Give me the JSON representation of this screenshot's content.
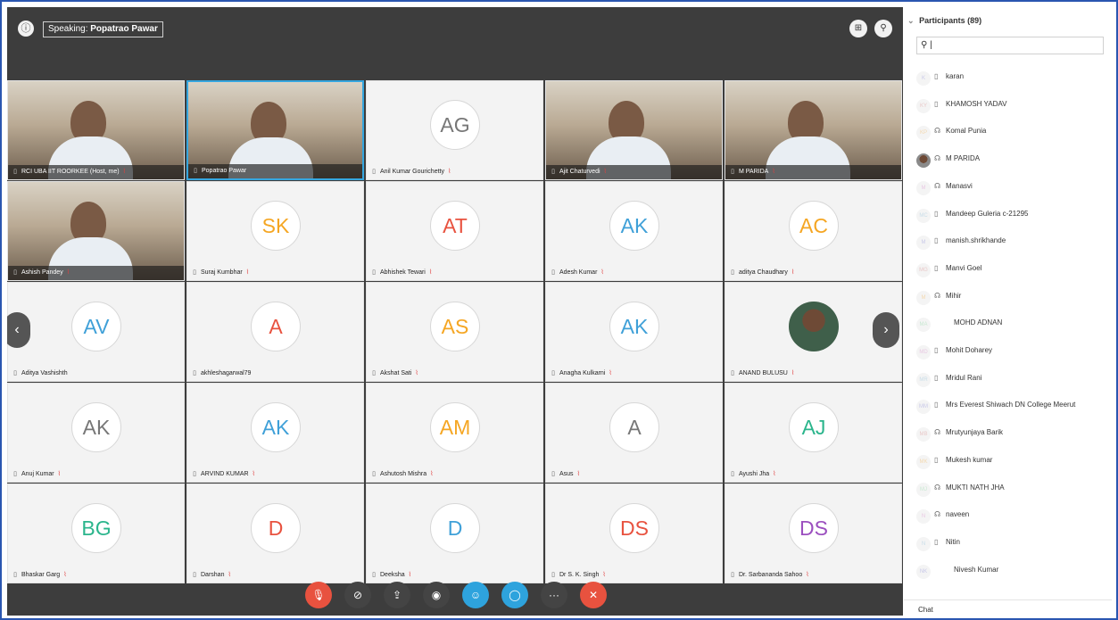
{
  "topbar": {
    "info_icon": "info-icon",
    "speaking_label": "Speaking:",
    "speaking_name": "Popatrao Pawar",
    "layout_icon": "grid-layout-icon",
    "options_icon": "pin-icon"
  },
  "tiles": [
    {
      "name": "RCI UBA IIT ROORKEE (Host, me)",
      "type": "video",
      "muted": true
    },
    {
      "name": "Popatrao Pawar",
      "type": "video",
      "active": true
    },
    {
      "name": "Anil Kumar Gourichetty",
      "initials": "AG",
      "color": "#777777",
      "muted": true
    },
    {
      "name": "Ajit Chaturvedi",
      "type": "video",
      "muted": true
    },
    {
      "name": "M PARIDA",
      "type": "video",
      "muted": true
    },
    {
      "name": "Ashish Pandey",
      "type": "video",
      "muted": true
    },
    {
      "name": "Suraj Kumbhar",
      "initials": "SK",
      "color": "#f5a623",
      "muted": true
    },
    {
      "name": "Abhishek Tewari",
      "initials": "AT",
      "color": "#e8523f",
      "muted": true
    },
    {
      "name": "Adesh Kumar",
      "initials": "AK",
      "color": "#3fa0d8",
      "muted": true
    },
    {
      "name": "aditya Chaudhary",
      "initials": "AC",
      "color": "#f5a623",
      "muted": true
    },
    {
      "name": "Aditya Vashishth",
      "initials": "AV",
      "color": "#3fa0d8"
    },
    {
      "name": "akhleshagarwal79",
      "initials": "A",
      "color": "#e8523f"
    },
    {
      "name": "Akshat Sati",
      "initials": "AS",
      "color": "#f5a623",
      "muted": true
    },
    {
      "name": "Anagha Kulkarni",
      "initials": "AK",
      "color": "#3fa0d8",
      "muted": true
    },
    {
      "name": "ANAND BULUSU",
      "type": "photo",
      "muted": true
    },
    {
      "name": "Anuj Kumar",
      "initials": "AK",
      "color": "#777777",
      "muted": true
    },
    {
      "name": "ARVIND KUMAR",
      "initials": "AK",
      "color": "#3fa0d8",
      "muted": true
    },
    {
      "name": "Ashutosh Mishra",
      "initials": "AM",
      "color": "#f5a623",
      "muted": true
    },
    {
      "name": "Asus",
      "initials": "A",
      "color": "#777777",
      "muted": true
    },
    {
      "name": "Ayushi Jha",
      "initials": "AJ",
      "color": "#2bb58c",
      "muted": true
    },
    {
      "name": "Bhaskar Garg",
      "initials": "BG",
      "color": "#2bb58c",
      "muted": true
    },
    {
      "name": "Darshan",
      "initials": "D",
      "color": "#e8523f",
      "muted": true
    },
    {
      "name": "Deeksha",
      "initials": "D",
      "color": "#3fa0d8",
      "muted": true
    },
    {
      "name": "Dr S. K. Singh",
      "initials": "DS",
      "color": "#e8523f",
      "muted": true
    },
    {
      "name": "Dr. Sarbananda Sahoo",
      "initials": "DS",
      "color": "#9b4fbf",
      "muted": true
    }
  ],
  "controls": [
    {
      "name": "mute-button",
      "icon": "microphone-off-icon",
      "glyph": "🎙",
      "color": "#e8523f"
    },
    {
      "name": "video-button",
      "icon": "video-off-icon",
      "glyph": "⊘",
      "color": "#444444"
    },
    {
      "name": "share-button",
      "icon": "share-screen-icon",
      "glyph": "⇪",
      "color": "#444444"
    },
    {
      "name": "record-button",
      "icon": "record-icon",
      "glyph": "◉",
      "color": "#444444"
    },
    {
      "name": "participants-button",
      "icon": "participants-icon",
      "glyph": "☺",
      "color": "#2ea3dd"
    },
    {
      "name": "chat-button",
      "icon": "chat-icon",
      "glyph": "◯",
      "color": "#2ea3dd"
    },
    {
      "name": "more-button",
      "icon": "more-icon",
      "glyph": "···",
      "color": "#444444"
    },
    {
      "name": "leave-button",
      "icon": "close-icon",
      "glyph": "✕",
      "color": "#e8523f"
    }
  ],
  "panel": {
    "title": "Participants (89)",
    "search_value": "",
    "chat_label": "Chat",
    "participants": [
      {
        "initials": "K",
        "name": "karan",
        "mic": "▯"
      },
      {
        "initials": "KY",
        "name": "KHAMOSH YADAV",
        "mic": "▯"
      },
      {
        "initials": "KP",
        "name": "Komal Punia",
        "mic": "☊"
      },
      {
        "initials": "MP",
        "name": "M PARIDA",
        "mic": "☊",
        "photo": true
      },
      {
        "initials": "M",
        "name": "Manasvi",
        "mic": "☊"
      },
      {
        "initials": "MC",
        "name": "Mandeep Guleria c-21295",
        "mic": "▯"
      },
      {
        "initials": "M",
        "name": "manish.shrikhande",
        "mic": "▯"
      },
      {
        "initials": "MG",
        "name": "Manvi Goel",
        "mic": "▯"
      },
      {
        "initials": "M",
        "name": "Mihir",
        "mic": "☊"
      },
      {
        "initials": "MA",
        "name": "MOHD ADNAN",
        "mic": ""
      },
      {
        "initials": "MD",
        "name": "Mohit Doharey",
        "mic": "▯"
      },
      {
        "initials": "MR",
        "name": "Mridul Rani",
        "mic": "▯"
      },
      {
        "initials": "MM",
        "name": "Mrs Everest Shiwach DN College Meerut",
        "mic": "▯"
      },
      {
        "initials": "MB",
        "name": "Mrutyunjaya Barik",
        "mic": "☊"
      },
      {
        "initials": "MK",
        "name": "Mukesh kumar",
        "mic": "▯"
      },
      {
        "initials": "MJ",
        "name": "MUKTI NATH JHA",
        "mic": "☊"
      },
      {
        "initials": "N",
        "name": "naveen",
        "mic": "☊"
      },
      {
        "initials": "N",
        "name": "Nitin",
        "mic": "▯"
      },
      {
        "initials": "NK",
        "name": "Nivesh Kumar",
        "mic": ""
      }
    ]
  }
}
